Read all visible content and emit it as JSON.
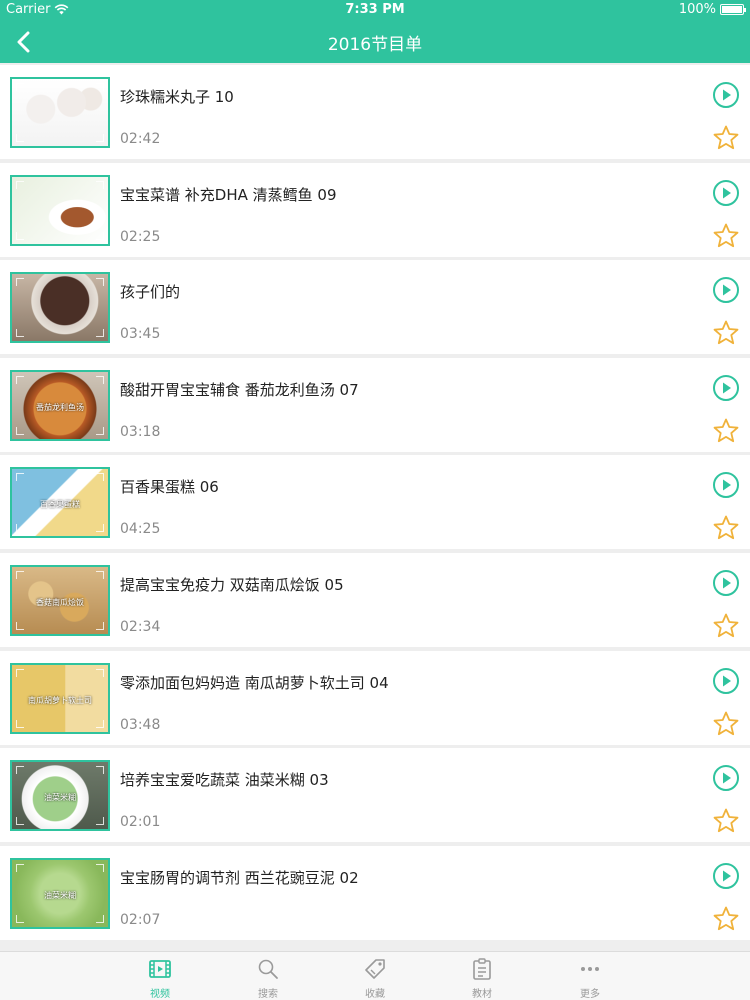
{
  "status_bar": {
    "carrier": "Carrier",
    "time": "7:33 PM",
    "battery": "100%"
  },
  "nav": {
    "title": "2016节目单",
    "back_icon": "chevron-left-icon"
  },
  "colors": {
    "accent": "#2fc39e",
    "star": "#f0b23a",
    "duration": "#8a8a8a"
  },
  "items": [
    {
      "title": "珍珠糯米丸子 10",
      "duration": "02:42",
      "thumb_caption": ""
    },
    {
      "title": "宝宝菜谱 补充DHA 清蒸鳕鱼 09",
      "duration": "02:25",
      "thumb_caption": ""
    },
    {
      "title": "孩子们的",
      "duration": "03:45",
      "thumb_caption": ""
    },
    {
      "title": "酸甜开胃宝宝辅食 番茄龙利鱼汤 07",
      "duration": "03:18",
      "thumb_caption": "番茄龙利鱼汤"
    },
    {
      "title": "百香果蛋糕 06",
      "duration": "04:25",
      "thumb_caption": "百香果蛋糕"
    },
    {
      "title": "提高宝宝免疫力 双菇南瓜烩饭 05",
      "duration": "02:34",
      "thumb_caption": "香菇南瓜烩饭"
    },
    {
      "title": "零添加面包妈妈造 南瓜胡萝卜软土司 04",
      "duration": "03:48",
      "thumb_caption": "南瓜胡萝卜软土司"
    },
    {
      "title": "培养宝宝爱吃蔬菜 油菜米糊 03",
      "duration": "02:01",
      "thumb_caption": "油菜米糊"
    },
    {
      "title": "宝宝肠胃的调节剂 西兰花豌豆泥 02",
      "duration": "02:07",
      "thumb_caption": "油菜米糊"
    }
  ],
  "tabs": [
    {
      "label": "视频",
      "icon": "film-icon",
      "active": true
    },
    {
      "label": "搜索",
      "icon": "search-icon",
      "active": false
    },
    {
      "label": "收藏",
      "icon": "tag-icon",
      "active": false
    },
    {
      "label": "教材",
      "icon": "clipboard-icon",
      "active": false
    },
    {
      "label": "更多",
      "icon": "more-icon",
      "active": false
    }
  ]
}
